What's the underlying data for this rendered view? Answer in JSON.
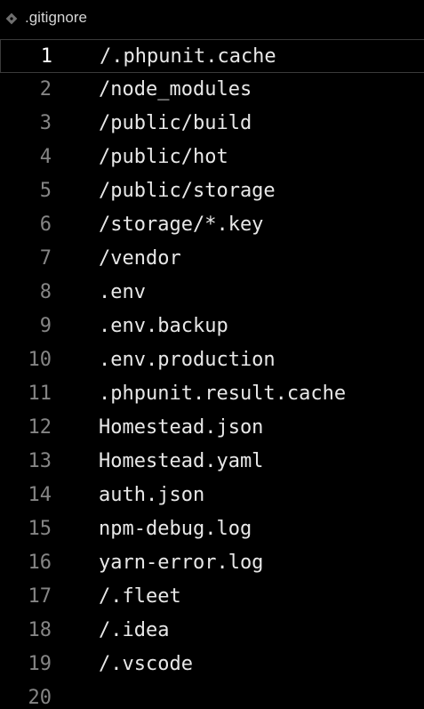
{
  "tab": {
    "filename": ".gitignore",
    "icon": "git-diamond-icon"
  },
  "editor": {
    "current_line": 1,
    "lines": [
      {
        "number": "1",
        "text": "/.phpunit.cache"
      },
      {
        "number": "2",
        "text": "/node_modules"
      },
      {
        "number": "3",
        "text": "/public/build"
      },
      {
        "number": "4",
        "text": "/public/hot"
      },
      {
        "number": "5",
        "text": "/public/storage"
      },
      {
        "number": "6",
        "text": "/storage/*.key"
      },
      {
        "number": "7",
        "text": "/vendor"
      },
      {
        "number": "8",
        "text": ".env"
      },
      {
        "number": "9",
        "text": ".env.backup"
      },
      {
        "number": "10",
        "text": ".env.production"
      },
      {
        "number": "11",
        "text": ".phpunit.result.cache"
      },
      {
        "number": "12",
        "text": "Homestead.json"
      },
      {
        "number": "13",
        "text": "Homestead.yaml"
      },
      {
        "number": "14",
        "text": "auth.json"
      },
      {
        "number": "15",
        "text": "npm-debug.log"
      },
      {
        "number": "16",
        "text": "yarn-error.log"
      },
      {
        "number": "17",
        "text": "/.fleet"
      },
      {
        "number": "18",
        "text": "/.idea"
      },
      {
        "number": "19",
        "text": "/.vscode"
      },
      {
        "number": "20",
        "text": ""
      }
    ]
  },
  "colors": {
    "background": "#000000",
    "text": "#e8e8e8",
    "line_number": "#858585",
    "current_line_number": "#ffffff"
  }
}
